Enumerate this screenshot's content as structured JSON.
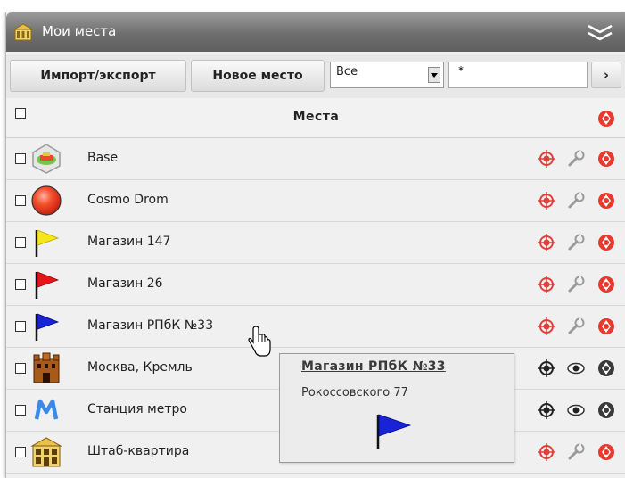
{
  "panel": {
    "title": "Мои места",
    "title_icon": "building-icon",
    "collapse_icon": "double-chevron-down-icon"
  },
  "toolbar": {
    "import_export_label": "Импорт/экспорт",
    "new_place_label": "Новое место",
    "filter_select_value": "Все",
    "filter_input_value": "*",
    "next_label": "›"
  },
  "table": {
    "header_label": "Места",
    "rows": [
      {
        "label": "Base",
        "icon": "base-icon",
        "actions": [
          "target-icon",
          "wrench-icon",
          "delete-icon"
        ]
      },
      {
        "label": "Cosmo Drom",
        "icon": "red-ball-icon",
        "actions": [
          "target-icon",
          "wrench-icon",
          "delete-icon"
        ]
      },
      {
        "label": "Магазин 147",
        "icon": "yellow-flag-icon",
        "actions": [
          "target-icon",
          "wrench-icon",
          "delete-icon"
        ]
      },
      {
        "label": "Магазин 26",
        "icon": "red-flag-icon",
        "actions": [
          "target-icon",
          "wrench-icon",
          "delete-icon"
        ]
      },
      {
        "label": "Магазин РПбК №33",
        "icon": "blue-flag-icon",
        "actions": [
          "target-icon",
          "wrench-icon",
          "delete-icon"
        ]
      },
      {
        "label": "Москва, Кремль",
        "icon": "castle-icon",
        "actions": [
          "target-icon",
          "eye-icon",
          "delete-icon"
        ]
      },
      {
        "label": "Станция метро",
        "icon": "metro-icon",
        "actions": [
          "target-icon",
          "eye-icon",
          "delete-icon"
        ]
      },
      {
        "label": "Штаб-квартира",
        "icon": "headquarters-icon",
        "actions": [
          "target-icon",
          "wrench-icon",
          "delete-icon"
        ]
      }
    ]
  },
  "tooltip": {
    "title": "Магазин РПбК №33",
    "address": "Рокоссовского 77",
    "icon": "blue-flag-icon"
  },
  "colors": {
    "titlebar": "#6e6e6e",
    "delete_red": "#e8392c",
    "delete_dark": "#3a3a3a",
    "target_red": "#e0403a",
    "flag_yellow": "#f5e51a",
    "flag_red": "#e8141c",
    "flag_blue": "#1a22d8",
    "metro_blue": "#3c8ae6"
  }
}
